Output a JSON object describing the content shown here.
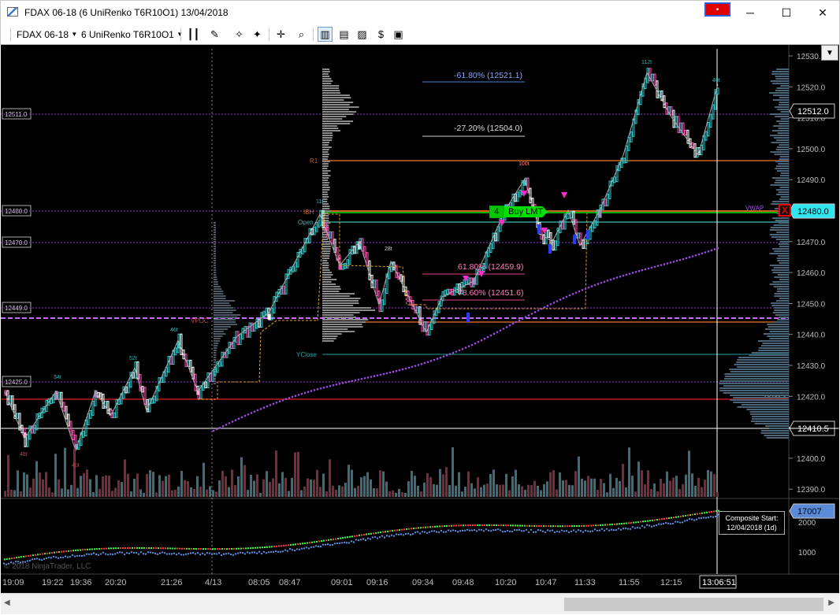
{
  "window": {
    "title": "FDAX 06-18 (6 UniRenko T6R10O1)  13/04/2018",
    "minimize": "─",
    "maximize": "☐",
    "close": "✕"
  },
  "toolbar": {
    "instrument": "FDAX 06-18",
    "bartype": "6 UniRenko T6R10O1"
  },
  "colors": {
    "background": "#000000",
    "grid": "#3a3a3a",
    "up": "#30c8c8",
    "down": "#ff4fb4",
    "vwap": "#9b4fe0",
    "buy": "#00e000",
    "fib_blue": "#4a7bd8"
  },
  "price_axis": {
    "labels": [
      "12530.0",
      "12520.0",
      "12510.0",
      "12500.0",
      "12490.0",
      "12480.0",
      "12470.0",
      "12460.0",
      "12450.0",
      "12440.0",
      "12430.0",
      "12420.0",
      "12410.0",
      "12400.0",
      "12390.0"
    ],
    "current_price": "12512.0",
    "crosshair_price": "12410.5",
    "order_price": "12480.0",
    "vol_profile_label": "12420.0"
  },
  "left_axis_labels": [
    "12511.0",
    "12480.0",
    "12470.0",
    "12449.0",
    "12425.0"
  ],
  "indicator_axis": {
    "labels": [
      "2000",
      "1000"
    ],
    "current": "17007"
  },
  "time_axis": {
    "labels": [
      "19:09",
      "19:22",
      "19:36",
      "20:20",
      "21:26",
      "4/13",
      "08:05",
      "08:47",
      "09:01",
      "09:16",
      "09:34",
      "09:48",
      "10:20",
      "10:47",
      "11:33",
      "11:55",
      "12:15"
    ],
    "crosshair_time": "13:06:51"
  },
  "fib_levels": [
    {
      "label": "-61.80% (12521.1)"
    },
    {
      "label": "-27.20% (12504.0)"
    },
    {
      "label": "61.80% (12459.9)"
    },
    {
      "label": "78.60% (12451.6)"
    }
  ],
  "level_labels": [
    "R1",
    "IBH",
    "Open",
    "VPOC",
    "YClose",
    "VWAP"
  ],
  "annotations": [
    "112t",
    "100t",
    "40t",
    "11t",
    "28t",
    "46t",
    "52t",
    "34t",
    "48t",
    "40t"
  ],
  "order": {
    "qty": "4",
    "label": "Buy LMT",
    "cancel": "X"
  },
  "composite": {
    "line1": "Composite Start:",
    "line2": "12/04/2018 (1d)"
  },
  "copyright": "© 2018 NinjaTrader, LLC"
}
